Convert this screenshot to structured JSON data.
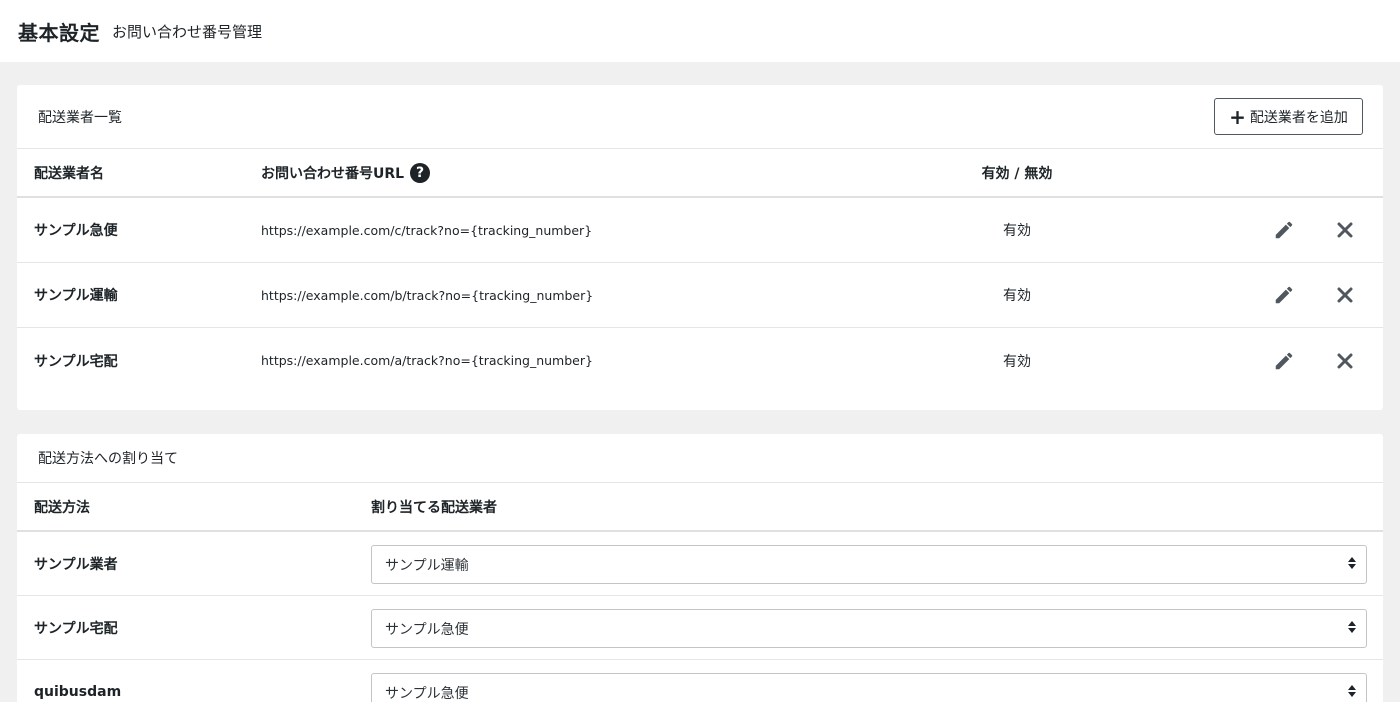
{
  "header": {
    "title": "基本設定",
    "subtitle": "お問い合わせ番号管理"
  },
  "carriers_panel": {
    "title": "配送業者一覧",
    "add_button_label": "配送業者を追加",
    "columns": {
      "name": "配送業者名",
      "url": "お問い合わせ番号URL",
      "status": "有効 / 無効"
    },
    "rows": [
      {
        "name": "サンプル急便",
        "url": "https://example.com/c/track?no={tracking_number}",
        "status": "有効"
      },
      {
        "name": "サンプル運輸",
        "url": "https://example.com/b/track?no={tracking_number}",
        "status": "有効"
      },
      {
        "name": "サンプル宅配",
        "url": "https://example.com/a/track?no={tracking_number}",
        "status": "有効"
      }
    ]
  },
  "assign_panel": {
    "title": "配送方法への割り当て",
    "columns": {
      "method": "配送方法",
      "carrier": "割り当てる配送業者"
    },
    "rows": [
      {
        "method": "サンプル業者",
        "carrier": "サンプル運輸"
      },
      {
        "method": "サンプル宅配",
        "carrier": "サンプル急便"
      },
      {
        "method": "quibusdam",
        "carrier": "サンプル急便"
      }
    ]
  },
  "icons": {
    "plus": "plus-icon",
    "help": "question-circle-icon",
    "edit": "pencil-icon",
    "delete": "close-icon",
    "select": "select-arrows-icon"
  }
}
